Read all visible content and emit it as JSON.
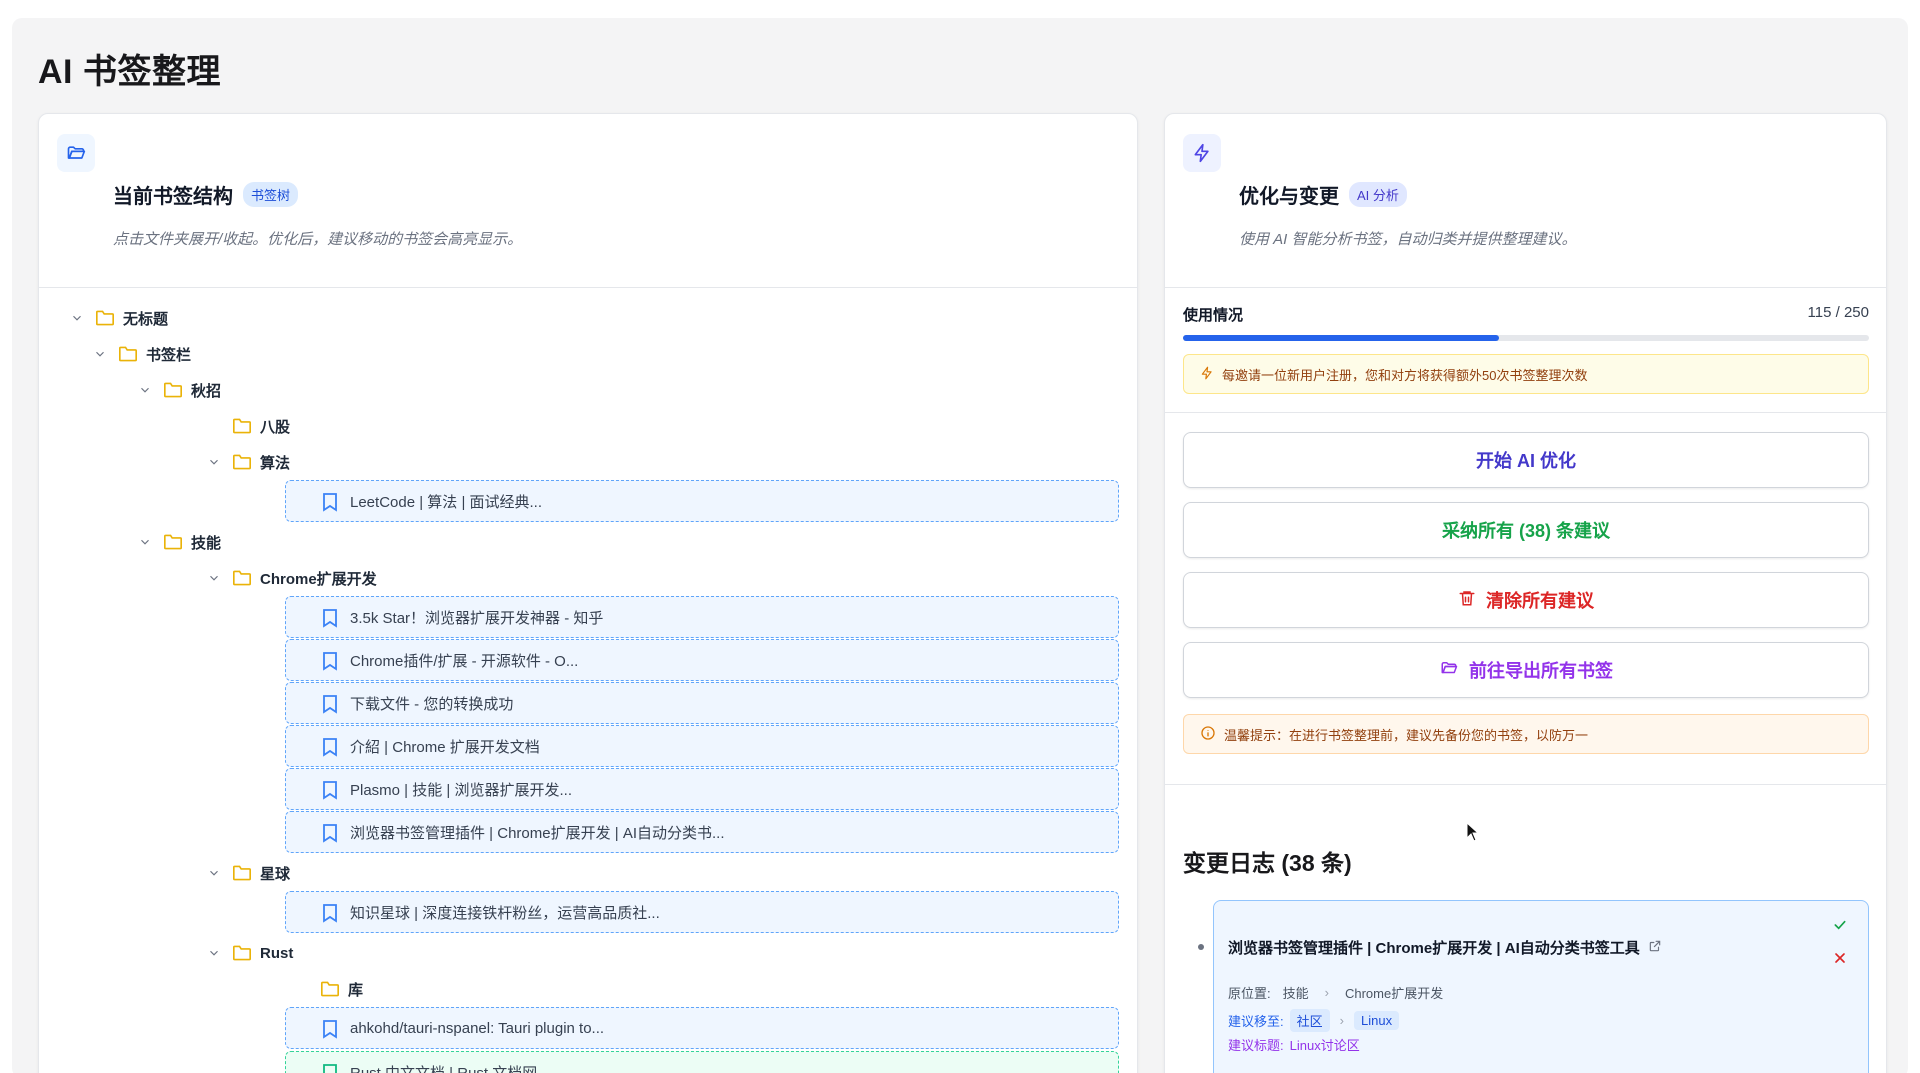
{
  "page": {
    "title": "AI 书签整理"
  },
  "left": {
    "title": "当前书签结构",
    "badge": "书签树",
    "description": "点击文件夹展开/收起。优化后，建议移动的书签会高亮显示。",
    "tree": [
      {
        "type": "folder",
        "label": "无标题",
        "expanded": true,
        "level": 0
      },
      {
        "type": "folder",
        "label": "书签栏",
        "expanded": true,
        "level": 1
      },
      {
        "type": "folder",
        "label": "秋招",
        "expanded": true,
        "level": 2
      },
      {
        "type": "folder",
        "label": "八股",
        "expanded": false,
        "level": 3
      },
      {
        "type": "folder",
        "label": "算法",
        "expanded": true,
        "level": 3
      },
      {
        "type": "bookmark",
        "label": "LeetCode | 算法 | 面试经典...",
        "style": "blue"
      },
      {
        "type": "folder",
        "label": "技能",
        "expanded": true,
        "level": 2
      },
      {
        "type": "folder",
        "label": "Chrome扩展开发",
        "expanded": true,
        "level": 3
      },
      {
        "type": "bookmark",
        "label": "3.5k Star！浏览器扩展开发神器 - 知乎",
        "style": "blue"
      },
      {
        "type": "bookmark",
        "label": "Chrome插件/扩展 - 开源软件 - O...",
        "style": "blue"
      },
      {
        "type": "bookmark",
        "label": "下载文件 - 您的转换成功",
        "style": "blue"
      },
      {
        "type": "bookmark",
        "label": "介紹 | Chrome 扩展开发文档",
        "style": "blue"
      },
      {
        "type": "bookmark",
        "label": "Plasmo | 技能 | 浏览器扩展开发...",
        "style": "blue"
      },
      {
        "type": "bookmark",
        "label": "浏览器书签管理插件 | Chrome扩展开发 | AI自动分类书...",
        "style": "blue"
      },
      {
        "type": "folder",
        "label": "星球",
        "expanded": true,
        "level": 3
      },
      {
        "type": "bookmark",
        "label": "知识星球 | 深度连接铁杆粉丝，运营高品质社...",
        "style": "blue"
      },
      {
        "type": "folder",
        "label": "Rust",
        "expanded": true,
        "level": 3
      },
      {
        "type": "folder",
        "label": "库",
        "expanded": false,
        "level": 4
      },
      {
        "type": "bookmark",
        "label": "ahkohd/tauri-nspanel: Tauri plugin to...",
        "style": "blue"
      },
      {
        "type": "bookmark",
        "label": "Rust 中文文档 | Rust 文档网",
        "style": "green"
      }
    ]
  },
  "right": {
    "title": "优化与变更",
    "badge": "AI 分析",
    "description": "使用 AI 智能分析书签，自动归类并提供整理建议。",
    "usage": {
      "label": "使用情况",
      "used": 115,
      "total": 250,
      "text": "115 / 250"
    },
    "invite_notice": "每邀请一位新用户注册，您和对方将获得额外50次书签整理次数",
    "buttons": {
      "start": "开始 AI 优化",
      "accept_all": "采纳所有 (38) 条建议",
      "clear_all": "清除所有建议",
      "export": "前往导出所有书签"
    },
    "warning": "温馨提示：在进行书签整理前，建议先备份您的书签，以防万一",
    "log": {
      "title": "变更日志 (38 条)",
      "entry": {
        "name": "浏览器书签管理插件 | Chrome扩展开发 | AI自动分类书签工具",
        "orig_label": "原位置:",
        "orig_path": [
          "技能",
          "Chrome扩展开发"
        ],
        "move_label": "建议移至:",
        "move_path": [
          "社区",
          "Linux"
        ],
        "title_label": "建议标题:",
        "title_value": "Linux讨论区"
      }
    }
  },
  "colors": {
    "accent": "#2563eb",
    "highlight": "#eff6ff",
    "green": "#16a34a",
    "red": "#dc2626",
    "purple": "#9333ea"
  }
}
